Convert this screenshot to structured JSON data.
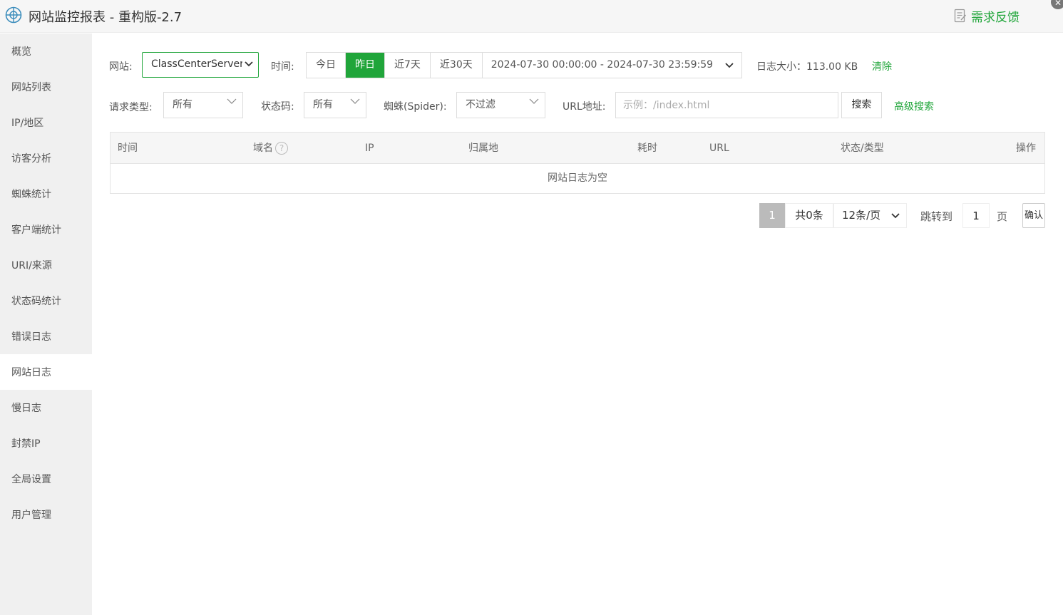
{
  "app": {
    "title": "网站监控报表 - 重构版-2.7",
    "feedback_label": "需求反馈",
    "close_glyph": "✕"
  },
  "sidebar": {
    "items": [
      {
        "label": "概览"
      },
      {
        "label": "网站列表"
      },
      {
        "label": "IP/地区"
      },
      {
        "label": "访客分析"
      },
      {
        "label": "蜘蛛统计"
      },
      {
        "label": "客户端统计"
      },
      {
        "label": "URI/来源"
      },
      {
        "label": "状态码统计"
      },
      {
        "label": "错误日志"
      },
      {
        "label": "网站日志"
      },
      {
        "label": "慢日志"
      },
      {
        "label": "封禁IP"
      },
      {
        "label": "全局设置"
      },
      {
        "label": "用户管理"
      }
    ],
    "active_index": 9
  },
  "filters": {
    "site_label": "网站:",
    "site_value": "ClassCenterServer",
    "time_label": "时间:",
    "time_buttons": [
      {
        "label": "今日"
      },
      {
        "label": "昨日"
      },
      {
        "label": "近7天"
      },
      {
        "label": "近30天"
      }
    ],
    "time_active": "昨日",
    "time_range": "2024-07-30 00:00:00 - 2024-07-30 23:59:59",
    "log_size": "日志大小：113.00 KB",
    "clear_label": "清除",
    "request_type_label": "请求类型:",
    "request_type_value": "所有",
    "status_code_label": "状态码:",
    "status_code_value": "所有",
    "spider_label": "蜘蛛(Spider):",
    "spider_value": "不过滤",
    "url_label": "URL地址:",
    "url_placeholder": "示例：/index.html",
    "search_label": "搜索",
    "advanced_label": "高级搜索"
  },
  "table": {
    "columns": [
      "时间",
      "域名",
      "IP",
      "归属地",
      "耗时",
      "URL",
      "状态/类型",
      "操作"
    ],
    "help_glyph": "?",
    "empty_text": "网站日志为空"
  },
  "pagination": {
    "current_page": "1",
    "total": "共0条",
    "page_size": "12条/页",
    "jump_label": "跳转到",
    "jump_value": "1",
    "page_unit": "页",
    "confirm_label": "确认"
  },
  "colors": {
    "accent": "#20a53a",
    "sidebar_bg": "#f0f0f0",
    "header_bg": "#f6f6f6"
  }
}
